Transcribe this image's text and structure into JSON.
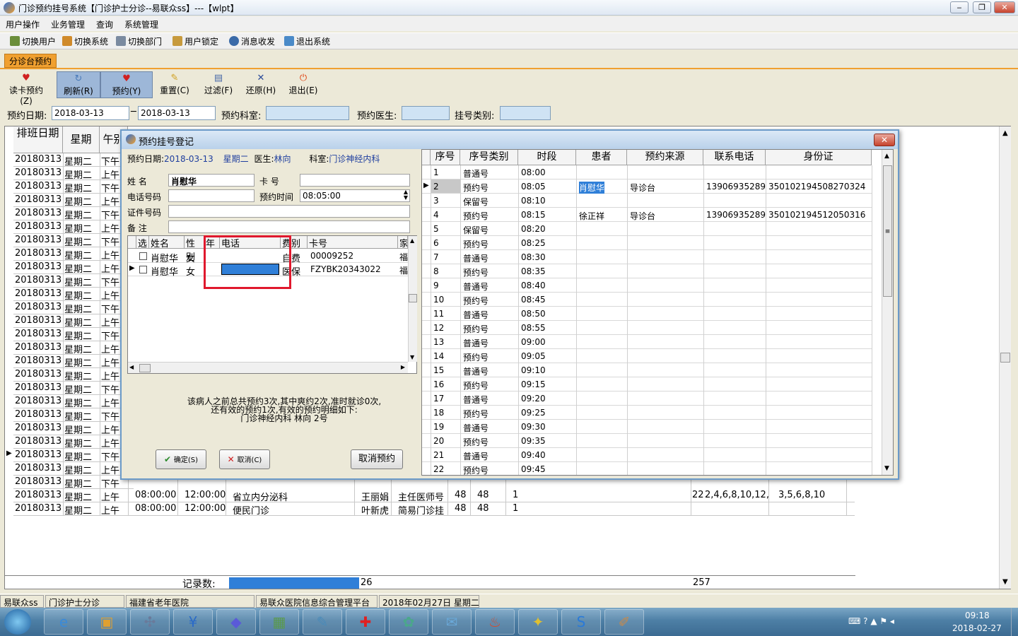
{
  "window": {
    "title": "门诊预约挂号系统【门诊护士分诊--易联众ss】---【wlpt】",
    "min": "‒",
    "max": "❐",
    "close": "✕"
  },
  "menu": [
    "用户操作",
    "业务管理",
    "查询",
    "系统管理"
  ],
  "toolbar1": [
    {
      "label": "切换用户",
      "icon": "users-icon"
    },
    {
      "label": "切换系统",
      "icon": "switch-system-icon"
    },
    {
      "label": "切换部门",
      "icon": "department-icon"
    },
    {
      "label": "用户锁定",
      "icon": "lock-user-icon"
    },
    {
      "label": "消息收发",
      "icon": "info-icon"
    },
    {
      "label": "退出系统",
      "icon": "exit-icon"
    }
  ],
  "tab": "分诊台预约",
  "toolbar2": [
    {
      "label": "读卡预约(Z)",
      "icon": "card-heart-icon",
      "pressed": false
    },
    {
      "label": "刷新(R)",
      "icon": "refresh-icon",
      "pressed": true
    },
    {
      "label": "预约(Y)",
      "icon": "heart-icon",
      "pressed": true
    },
    {
      "label": "重置(C)",
      "icon": "broom-icon",
      "pressed": false
    },
    {
      "label": "过滤(F)",
      "icon": "filter-icon",
      "pressed": false
    },
    {
      "label": "还原(H)",
      "icon": "restore-icon",
      "pressed": false
    },
    {
      "label": "退出(E)",
      "icon": "power-icon",
      "pressed": false
    }
  ],
  "filter": {
    "date_label": "预约日期:",
    "date_from": "2018-03-13",
    "dash": "─",
    "date_to": "2018-03-13",
    "dept_label": "预约科室:",
    "dept": "",
    "doctor_label": "预约医生:",
    "doctor": "",
    "type_label": "挂号类别:",
    "type": ""
  },
  "main_grid": {
    "headers": [
      "排班日期",
      "星期",
      "午别"
    ],
    "rows": [
      [
        "20180313",
        "星期二",
        "下午"
      ],
      [
        "20180313",
        "星期二",
        "上午"
      ],
      [
        "20180313",
        "星期二",
        "下午"
      ],
      [
        "20180313",
        "星期二",
        "上午"
      ],
      [
        "20180313",
        "星期二",
        "下午"
      ],
      [
        "20180313",
        "星期二",
        "上午"
      ],
      [
        "20180313",
        "星期二",
        "下午"
      ],
      [
        "20180313",
        "星期二",
        "上午"
      ],
      [
        "20180313",
        "星期二",
        "上午"
      ],
      [
        "20180313",
        "星期二",
        "下午"
      ],
      [
        "20180313",
        "星期二",
        "上午"
      ],
      [
        "20180313",
        "星期二",
        "下午"
      ],
      [
        "20180313",
        "星期二",
        "上午"
      ],
      [
        "20180313",
        "星期二",
        "下午"
      ],
      [
        "20180313",
        "星期二",
        "上午"
      ],
      [
        "20180313",
        "星期二",
        "上午"
      ],
      [
        "20180313",
        "星期二",
        "上午"
      ],
      [
        "20180313",
        "星期二",
        "下午"
      ],
      [
        "20180313",
        "星期二",
        "上午"
      ],
      [
        "20180313",
        "星期二",
        "下午"
      ],
      [
        "20180313",
        "星期二",
        "上午"
      ],
      [
        "20180313",
        "星期二",
        "上午"
      ],
      [
        "20180313",
        "星期二",
        "下午"
      ],
      [
        "20180313",
        "星期二",
        "上午"
      ],
      [
        "20180313",
        "星期二",
        "下午"
      ]
    ],
    "extra_rows": [
      {
        "date": "20180313",
        "week": "星期二",
        "ampm": "上午",
        "start": "08:00:00",
        "end": "12:00:00",
        "dept": "省立内分泌科",
        "doctor": "王丽娟",
        "title": "主任医师号",
        "n1": "48",
        "n2": "48",
        "n3": "1",
        "num": "22",
        "slots": "2,4,6,8,10,12,",
        "slots2": "3,5,6,8,10"
      },
      {
        "date": "20180313",
        "week": "星期二",
        "ampm": "上午",
        "start": "08:00:00",
        "end": "12:00:00",
        "dept": "便民门诊",
        "doctor": "叶新虎",
        "title": "简易门诊挂",
        "n1": "48",
        "n2": "48",
        "n3": "1",
        "num": "",
        "slots": "",
        "slots2": ""
      }
    ],
    "current_row_index": 22,
    "summary_label": "记录数:",
    "summary_value": "26",
    "summary_total": "257"
  },
  "dialog": {
    "title": "预约挂号登记",
    "close": "✕",
    "info_date_label": "预约日期:",
    "info_date": "2018-03-13",
    "info_week": "星期二",
    "info_doctor_label": "医生:",
    "info_doctor": "林向",
    "info_dept_label": "科室:",
    "info_dept": "门诊神经内科",
    "name_label": "姓    名",
    "name": "肖慰华",
    "card_label": "卡    号",
    "card": "",
    "phone_label": "电话号码",
    "phone": "",
    "time_label": "预约时间",
    "time": "08:05:00",
    "id_label": "证件号码",
    "id": "",
    "remark_label": "备    注",
    "remark": "",
    "patients_headers": [
      "选",
      "姓名",
      "性别",
      "年龄",
      "电话",
      "费别",
      "卡号",
      "家"
    ],
    "patients": [
      {
        "name": "肖慰华",
        "sex": "女",
        "age": "",
        "phone": "",
        "fee": "自费",
        "card": "00009252",
        "home": "福"
      },
      {
        "name": "肖慰华",
        "sex": "女",
        "age": "",
        "phone": "",
        "fee": "医保",
        "card": "FZYBK20343022",
        "home": "福"
      }
    ],
    "note_line1": "该病人之前总共预约3次,其中爽约2次,准时就诊0次,",
    "note_line2": "还有效的预约1次,有效的预约明细如下:",
    "note_line3": "门诊神经内科  林向  2号",
    "ok_label": "确定(S)",
    "cancel_label": "取消(C)",
    "cancel_booking_label": "取消预约",
    "slots_headers": [
      "序号",
      "序号类别",
      "时段",
      "患者",
      "预约来源",
      "联系电话",
      "身份证"
    ],
    "slots": [
      {
        "no": "1",
        "type": "普通号",
        "time": "08:00",
        "patient": "",
        "src": "",
        "tel": "",
        "idno": ""
      },
      {
        "no": "2",
        "type": "预约号",
        "time": "08:05",
        "patient": "肖慰华",
        "src": "导诊台",
        "tel": "13906935289",
        "idno": "350102194508270324"
      },
      {
        "no": "3",
        "type": "保留号",
        "time": "08:10",
        "patient": "",
        "src": "",
        "tel": "",
        "idno": ""
      },
      {
        "no": "4",
        "type": "预约号",
        "time": "08:15",
        "patient": "徐正祥",
        "src": "导诊台",
        "tel": "13906935289",
        "idno": "350102194512050316"
      },
      {
        "no": "5",
        "type": "保留号",
        "time": "08:20",
        "patient": "",
        "src": "",
        "tel": "",
        "idno": ""
      },
      {
        "no": "6",
        "type": "预约号",
        "time": "08:25",
        "patient": "",
        "src": "",
        "tel": "",
        "idno": ""
      },
      {
        "no": "7",
        "type": "普通号",
        "time": "08:30",
        "patient": "",
        "src": "",
        "tel": "",
        "idno": ""
      },
      {
        "no": "8",
        "type": "预约号",
        "time": "08:35",
        "patient": "",
        "src": "",
        "tel": "",
        "idno": ""
      },
      {
        "no": "9",
        "type": "普通号",
        "time": "08:40",
        "patient": "",
        "src": "",
        "tel": "",
        "idno": ""
      },
      {
        "no": "10",
        "type": "预约号",
        "time": "08:45",
        "patient": "",
        "src": "",
        "tel": "",
        "idno": ""
      },
      {
        "no": "11",
        "type": "普通号",
        "time": "08:50",
        "patient": "",
        "src": "",
        "tel": "",
        "idno": ""
      },
      {
        "no": "12",
        "type": "预约号",
        "time": "08:55",
        "patient": "",
        "src": "",
        "tel": "",
        "idno": ""
      },
      {
        "no": "13",
        "type": "普通号",
        "time": "09:00",
        "patient": "",
        "src": "",
        "tel": "",
        "idno": ""
      },
      {
        "no": "14",
        "type": "预约号",
        "time": "09:05",
        "patient": "",
        "src": "",
        "tel": "",
        "idno": ""
      },
      {
        "no": "15",
        "type": "普通号",
        "time": "09:10",
        "patient": "",
        "src": "",
        "tel": "",
        "idno": ""
      },
      {
        "no": "16",
        "type": "预约号",
        "time": "09:15",
        "patient": "",
        "src": "",
        "tel": "",
        "idno": ""
      },
      {
        "no": "17",
        "type": "普通号",
        "time": "09:20",
        "patient": "",
        "src": "",
        "tel": "",
        "idno": ""
      },
      {
        "no": "18",
        "type": "预约号",
        "time": "09:25",
        "patient": "",
        "src": "",
        "tel": "",
        "idno": ""
      },
      {
        "no": "19",
        "type": "普通号",
        "time": "09:30",
        "patient": "",
        "src": "",
        "tel": "",
        "idno": ""
      },
      {
        "no": "20",
        "type": "预约号",
        "time": "09:35",
        "patient": "",
        "src": "",
        "tel": "",
        "idno": ""
      },
      {
        "no": "21",
        "type": "普通号",
        "time": "09:40",
        "patient": "",
        "src": "",
        "tel": "",
        "idno": ""
      },
      {
        "no": "22",
        "type": "预约号",
        "time": "09:45",
        "patient": "",
        "src": "",
        "tel": "",
        "idno": ""
      }
    ],
    "selected_slot_index": 1
  },
  "statusbar": [
    "易联众ss",
    "门诊护士分诊",
    "福建省老年医院",
    "易联众医院信息综合管理平台",
    "2018年02月27日  星期二"
  ],
  "taskbar": {
    "apps": [
      "ie-icon",
      "app-window-icon",
      "compass-icon",
      "yuan-icon",
      "diamond-icon",
      "id-card-icon",
      "pencil-icon",
      "red-cross-icon",
      "network-icon",
      "chat-icon",
      "fire-icon",
      "puzzle-icon",
      "logo-s-icon",
      "paint-icon"
    ],
    "time": "09:18",
    "date": "2018-02-27"
  },
  "colors": {
    "accent": "#f0a030",
    "selection": "#2f7fd8",
    "highlight_box": "#e0182d"
  }
}
